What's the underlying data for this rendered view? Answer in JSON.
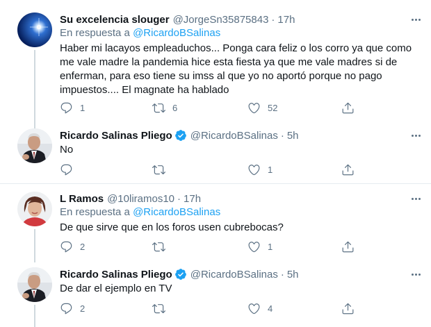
{
  "colors": {
    "link": "#1da1f2",
    "secondary": "#5b7083",
    "divider": "#e6ecf0",
    "verified": "#1da1f2"
  },
  "icons": {
    "reply": "reply-icon",
    "retweet": "retweet-icon",
    "like": "heart-icon",
    "share": "share-icon",
    "more": "more-icon",
    "verified": "verified-badge-icon"
  },
  "tweets": [
    {
      "name": "Su excelencia slouger",
      "handle": "@JorgeSn35875843",
      "dot": "·",
      "time": "17h",
      "reply_prefix": "En respuesta a",
      "reply_to": "@RicardoBSalinas",
      "text": "Haber mi lacayos empleaduchos... Ponga cara feliz o los corro ya que como me vale madre la pandemia hice esta fiesta ya que me vale madres si de enferman, para eso tiene su imss al que yo no aportó porque no pago impuestos.... El magnate ha hablado",
      "replies": "1",
      "retweets": "6",
      "likes": "52"
    },
    {
      "name": "Ricardo Salinas Pliego",
      "handle": "@RicardoBSalinas",
      "dot": "·",
      "time": "5h",
      "text": "No",
      "replies": "",
      "retweets": "",
      "likes": "1"
    },
    {
      "name": "L Ramos",
      "handle": "@10liramos10",
      "dot": "·",
      "time": "17h",
      "reply_prefix": "En respuesta a",
      "reply_to": "@RicardoBSalinas",
      "text": "De que sirve que en los foros usen cubrebocas?",
      "replies": "2",
      "retweets": "",
      "likes": "1"
    },
    {
      "name": "Ricardo Salinas Pliego",
      "handle": "@RicardoBSalinas",
      "dot": "·",
      "time": "5h",
      "text": "De dar el ejemplo en TV",
      "replies": "2",
      "retweets": "",
      "likes": "4"
    }
  ]
}
